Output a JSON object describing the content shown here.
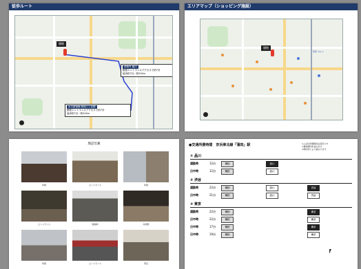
{
  "page1": {
    "title": "徒歩ルート",
    "target_label": "現地",
    "callout_top": {
      "tag": "伊勢丹 南口",
      "line1": "都営エントランスアクセスで約7分",
      "line2": "徒歩約7分／約500m"
    },
    "callout_bottom": {
      "tag": "京王新宿線 新宿三丁目駅",
      "line1": "都営エントランスアクセスで約7分",
      "line2": "徒歩約7分／約500m"
    }
  },
  "page2": {
    "title": "エリアマップ（ショッピング施設）",
    "target_label": "現地",
    "area_label": "東京 マルイ"
  },
  "page3": {
    "title": "周辺写真",
    "captions": [
      "外観",
      "エントランス",
      "外観",
      "エントランス",
      "駐輪場",
      "共用部",
      "外観",
      "エントランス",
      "周辺"
    ]
  },
  "page4": {
    "header": "●交通所要時間　京浜東北線「蒲田」駅",
    "notes": [
      "※上記の所要時間は目安です",
      "※乗換時間を含みます",
      "※時間帯により異なります"
    ],
    "sections": [
      {
        "num": "①",
        "dest": "品川",
        "rows": [
          {
            "label": "通勤時",
            "mins": "12分",
            "from": "蒲田",
            "to": "品川"
          },
          {
            "label": "日中時",
            "mins": "12分",
            "from": "蒲田",
            "to": "品川"
          }
        ]
      },
      {
        "num": "②",
        "dest": "渋谷",
        "rows": [
          {
            "label": "通勤時",
            "mins": "22分",
            "from": "蒲田",
            "via": "品川",
            "to": "渋谷"
          },
          {
            "label": "日中時",
            "mins": "21分",
            "from": "蒲田",
            "via": "品川",
            "to": "渋谷"
          }
        ]
      },
      {
        "num": "③",
        "dest": "東京",
        "rows": [
          {
            "label": "通勤時",
            "mins": "22分",
            "from": "蒲田",
            "to": "東京"
          },
          {
            "label": "日中時",
            "mins": "22分",
            "from": "蒲田",
            "to": "東京"
          },
          {
            "label": "日中時",
            "mins": "17分",
            "from": "蒲田",
            "to": "東京"
          },
          {
            "label": "日中時",
            "mins": "19分",
            "from": "蒲田",
            "to": "東京"
          }
        ]
      }
    ]
  }
}
